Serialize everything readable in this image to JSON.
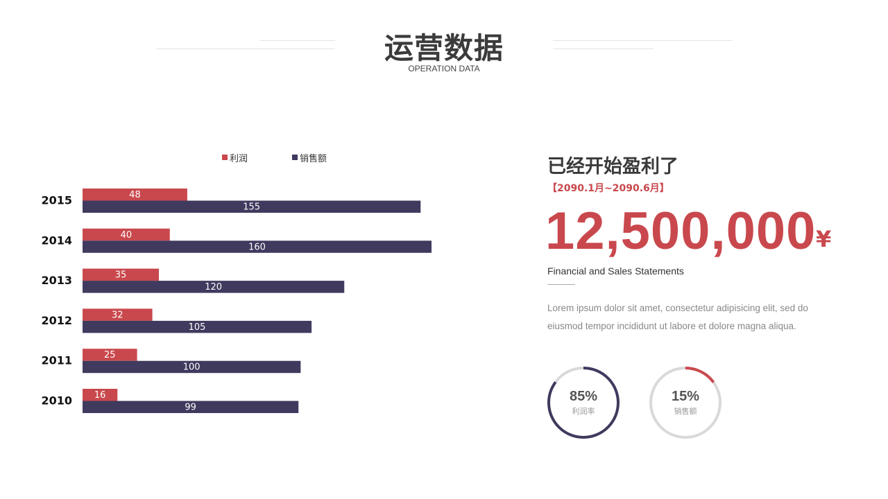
{
  "header": {
    "title": "运营数据",
    "subtitle": "OPERATION DATA"
  },
  "chart_data": {
    "type": "bar",
    "orientation": "horizontal",
    "categories": [
      "2015",
      "2014",
      "2013",
      "2012",
      "2011",
      "2010"
    ],
    "series": [
      {
        "name": "利润",
        "values": [
          48,
          40,
          35,
          32,
          25,
          16
        ],
        "color": "#c9484d"
      },
      {
        "name": "销售额",
        "values": [
          155,
          160,
          120,
          105,
          100,
          99
        ],
        "color": "#3f3a5e"
      }
    ],
    "xlim": [
      0,
      160
    ],
    "legend_position": "top",
    "grid": false,
    "data_labels": true
  },
  "summary": {
    "heading": "已经开始盈利了",
    "date_range": "【2090.1月~2090.6月】",
    "amount": "12,500,000",
    "currency": "¥",
    "caption": "Financial and Sales Statements",
    "body": "Lorem ipsum dolor sit amet, consectetur adipisicing elit, sed do eiusmod tempor incididunt ut labore et dolore magna aliqua."
  },
  "rings": [
    {
      "percent_label": "85%",
      "label": "利润率",
      "value": 0.85,
      "color": "#3f3a5e"
    },
    {
      "percent_label": "15%",
      "label": "销售额",
      "value": 0.15,
      "color": "#c9484d"
    }
  ],
  "colors": {
    "accent_red": "#c9484d",
    "accent_navy": "#3f3a5e",
    "ring_track": "#d9d9d9"
  }
}
